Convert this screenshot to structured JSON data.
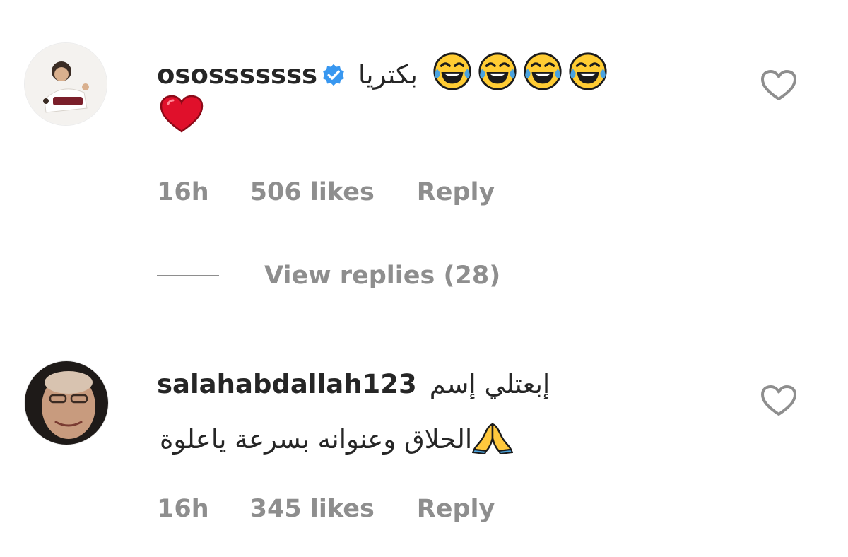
{
  "comments": [
    {
      "username": "ososssssss",
      "verified": true,
      "text_line1": "بكتريا",
      "emoji_line1": [
        "face-with-tears-of-joy",
        "face-with-tears-of-joy",
        "face-with-tears-of-joy",
        "face-with-tears-of-joy"
      ],
      "emoji_line2": "red-heart",
      "time": "16h",
      "likes": "506 likes",
      "reply": "Reply",
      "view_replies": "View replies (28)"
    },
    {
      "username": "salahabdallah123",
      "verified": false,
      "text_line1": "إبعتلي إسم",
      "text_line2": "الحلاق وعنوانه بسرعة ياعلوة",
      "emoji_line2": "folded-hands",
      "time": "16h",
      "likes": "345 likes",
      "reply": "Reply"
    }
  ],
  "colors": {
    "text": "#262626",
    "secondary": "#8e8e8e",
    "verified": "#3897f0",
    "heart_outline": "#8e8e8e",
    "red_heart": "#e0102b"
  }
}
